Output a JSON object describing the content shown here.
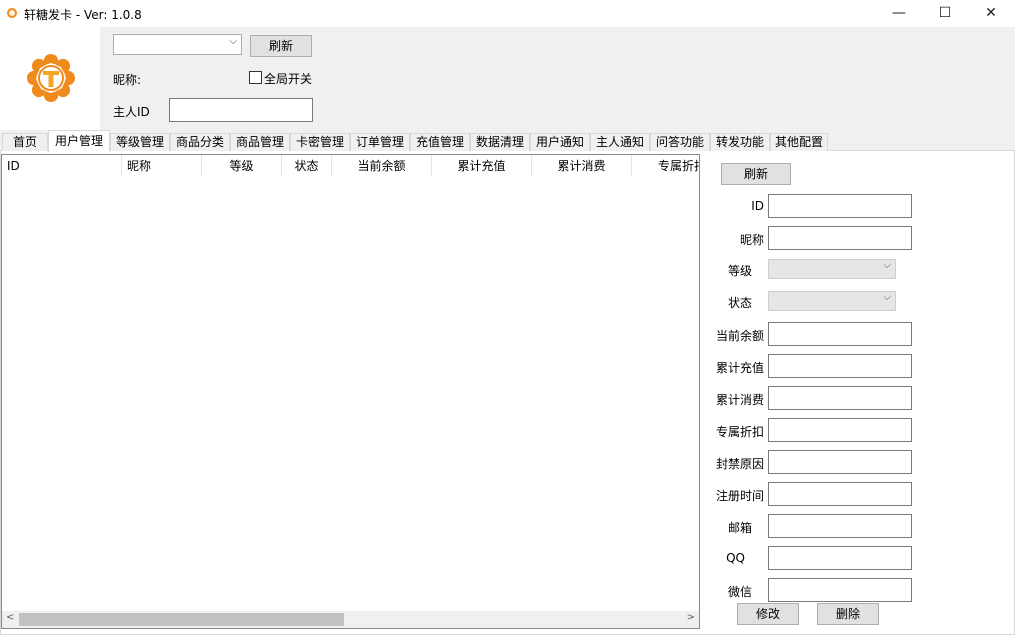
{
  "window": {
    "title": "轩糖发卡 - Ver: 1.0.8",
    "controls": {
      "minimize": "—",
      "maximize": "☐",
      "close": "✕"
    }
  },
  "header": {
    "combo_value": "",
    "refresh_label": "刷新",
    "nickname_label": "昵称:",
    "global_switch_label": "全局开关",
    "global_switch_checked": false,
    "owner_id_label": "主人ID",
    "owner_id_value": ""
  },
  "tabs": [
    {
      "label": "首页",
      "active": false
    },
    {
      "label": "用户管理",
      "active": true
    },
    {
      "label": "等级管理",
      "active": false
    },
    {
      "label": "商品分类",
      "active": false
    },
    {
      "label": "商品管理",
      "active": false
    },
    {
      "label": "卡密管理",
      "active": false
    },
    {
      "label": "订单管理",
      "active": false
    },
    {
      "label": "充值管理",
      "active": false
    },
    {
      "label": "数据清理",
      "active": false
    },
    {
      "label": "用户通知",
      "active": false
    },
    {
      "label": "主人通知",
      "active": false
    },
    {
      "label": "问答功能",
      "active": false
    },
    {
      "label": "转发功能",
      "active": false
    },
    {
      "label": "其他配置",
      "active": false
    }
  ],
  "grid": {
    "columns": [
      "ID",
      "昵称",
      "等级",
      "状态",
      "当前余额",
      "累计充值",
      "累计消费",
      "专属折扣"
    ],
    "rows": []
  },
  "side_form": {
    "refresh_label": "刷新",
    "fields": {
      "id": {
        "label": "ID",
        "value": ""
      },
      "nickname": {
        "label": "昵称",
        "value": ""
      },
      "level": {
        "label": "等级",
        "value": ""
      },
      "status": {
        "label": "状态",
        "value": ""
      },
      "balance": {
        "label": "当前余额",
        "value": ""
      },
      "total_recharge": {
        "label": "累计充值",
        "value": ""
      },
      "total_spend": {
        "label": "累计消费",
        "value": ""
      },
      "discount": {
        "label": "专属折扣",
        "value": ""
      },
      "ban_reason": {
        "label": "封禁原因",
        "value": ""
      },
      "register_time": {
        "label": "注册时间",
        "value": ""
      },
      "email": {
        "label": "邮箱",
        "value": ""
      },
      "qq": {
        "label": "QQ",
        "value": ""
      },
      "wechat": {
        "label": "微信",
        "value": ""
      }
    },
    "edit_label": "修改",
    "delete_label": "删除"
  },
  "colors": {
    "logo_outer": "#f08a1c",
    "logo_inner": "#f5a623",
    "panel_bg": "#f0f0f0"
  }
}
